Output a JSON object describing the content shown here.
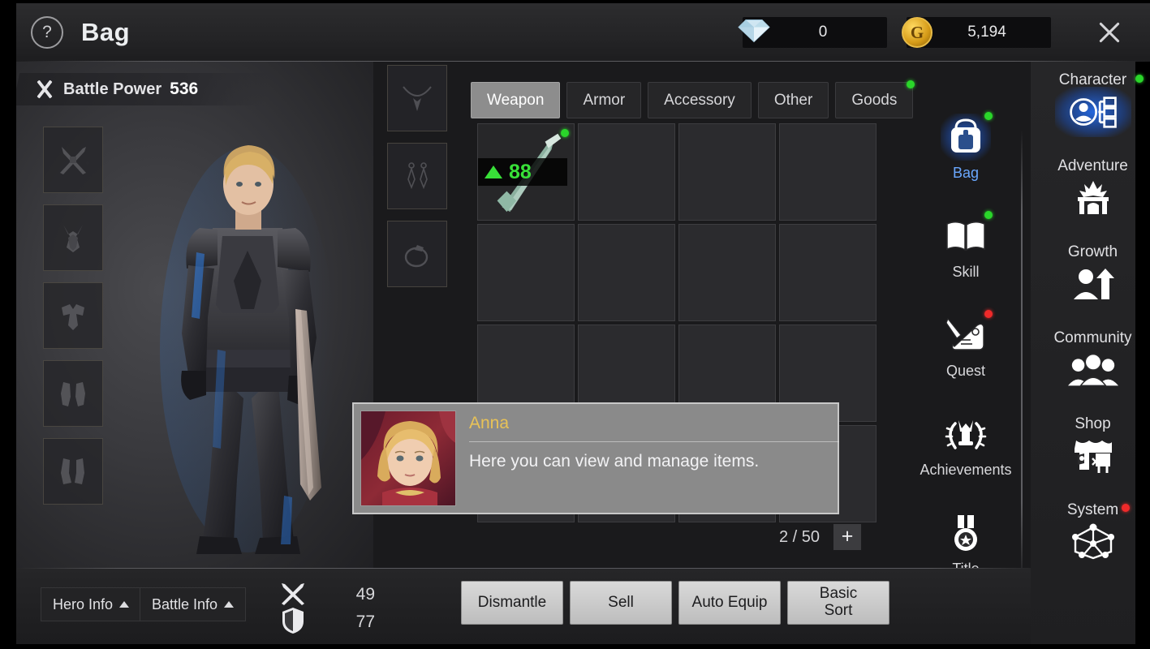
{
  "header": {
    "help_label": "?",
    "title": "Bag",
    "close_label": "",
    "currencies": [
      {
        "icon": "diamond-icon",
        "name": "diamond",
        "value": "0"
      },
      {
        "icon": "gold-coin-icon",
        "name": "gold",
        "symbol": "G",
        "value": "5,194"
      }
    ]
  },
  "character_panel": {
    "battle_power_label": "Battle Power",
    "battle_power_value": "536",
    "equipment_slots": [
      {
        "name": "weapon",
        "label": "Weapon"
      },
      {
        "name": "helmet",
        "label": "Helmet"
      },
      {
        "name": "chest",
        "label": "Chest"
      },
      {
        "name": "gloves",
        "label": "Gloves"
      },
      {
        "name": "boots",
        "label": "Boots"
      }
    ],
    "accessory_slots": [
      {
        "name": "necklace",
        "label": "Necklace"
      },
      {
        "name": "earring",
        "label": "Earring"
      },
      {
        "name": "ring",
        "label": "Ring"
      }
    ]
  },
  "inventory": {
    "tabs": [
      {
        "label": "Weapon",
        "active": true,
        "badge": ""
      },
      {
        "label": "Armor",
        "active": false,
        "badge": ""
      },
      {
        "label": "Accessory",
        "active": false,
        "badge": ""
      },
      {
        "label": "Other",
        "active": false,
        "badge": ""
      },
      {
        "label": "Goods",
        "active": false,
        "badge": "green"
      }
    ],
    "items": [
      {
        "slot": 0,
        "level": "88",
        "upgrade": true,
        "badge": "green",
        "type": "sword"
      }
    ],
    "capacity_text": "2 / 50",
    "add_slot_label": "+"
  },
  "menu_column": [
    {
      "label": "Bag",
      "icon": "backpack-icon",
      "active": true,
      "badge": "green"
    },
    {
      "label": "Skill",
      "icon": "book-icon",
      "active": false,
      "badge": "green"
    },
    {
      "label": "Quest",
      "icon": "scroll-quill-icon",
      "active": false,
      "badge": "red"
    },
    {
      "label": "Achievements",
      "icon": "trophy-wreath-icon",
      "active": false,
      "badge": ""
    },
    {
      "label": "Title",
      "icon": "medal-icon",
      "active": false,
      "badge": ""
    }
  ],
  "side_column": [
    {
      "label": "Character",
      "icon": "character-org-icon",
      "active": true,
      "badge": "green"
    },
    {
      "label": "Adventure",
      "icon": "gate-icon",
      "active": false,
      "badge": ""
    },
    {
      "label": "Growth",
      "icon": "person-arrow-up-icon",
      "active": false,
      "badge": ""
    },
    {
      "label": "Community",
      "icon": "people-group-icon",
      "active": false,
      "badge": ""
    },
    {
      "label": "Shop",
      "icon": "market-stall-icon",
      "active": false,
      "badge": ""
    },
    {
      "label": "System",
      "icon": "network-nodes-icon",
      "active": false,
      "badge": "red"
    }
  ],
  "bottom_bar": {
    "hero_info_label": "Hero Info",
    "battle_info_label": "Battle Info",
    "attack_value": "49",
    "defense_value": "77",
    "actions": [
      {
        "label": "Dismantle",
        "name": "dismantle"
      },
      {
        "label": "Sell",
        "name": "sell"
      },
      {
        "label": "Auto Equip",
        "name": "auto-equip"
      },
      {
        "label": "Basic Sort",
        "name": "basic-sort",
        "line1": "Basic",
        "line2": "Sort"
      }
    ]
  },
  "dialogue": {
    "speaker": "Anna",
    "text": "Here you can view and manage items."
  },
  "colors": {
    "accent_blue": "#6aa8ff",
    "badge_green": "#2ad62a",
    "badge_red": "#ef2a2a",
    "gold_text": "#e8c257",
    "item_green": "#38e038"
  }
}
